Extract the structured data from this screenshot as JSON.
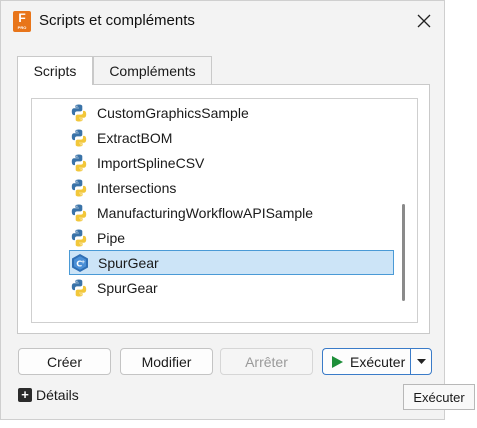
{
  "window": {
    "title": "Scripts et compléments",
    "app_icon_letter": "F",
    "app_icon_sub": "PRO"
  },
  "tabs": [
    {
      "label": "Scripts",
      "active": true
    },
    {
      "label": "Compléments",
      "active": false
    }
  ],
  "list": {
    "items": [
      {
        "label": "CustomGraphicsSample",
        "icon": "python-icon",
        "selected": false
      },
      {
        "label": "ExtractBOM",
        "icon": "python-icon",
        "selected": false
      },
      {
        "label": "ImportSplineCSV",
        "icon": "python-icon",
        "selected": false
      },
      {
        "label": "Intersections",
        "icon": "python-icon",
        "selected": false
      },
      {
        "label": "ManufacturingWorkflowAPISample",
        "icon": "python-icon",
        "selected": false
      },
      {
        "label": "Pipe",
        "icon": "python-icon",
        "selected": false
      },
      {
        "label": "SpurGear",
        "icon": "cpp-icon",
        "selected": true
      },
      {
        "label": "SpurGear",
        "icon": "python-icon",
        "selected": false
      }
    ]
  },
  "buttons": {
    "create": "Créer",
    "edit": "Modifier",
    "stop": "Arrêter",
    "run": "Exécuter"
  },
  "details_label": "Détails",
  "tooltip": "Exécuter",
  "colors": {
    "selection_bg": "#cce4f7",
    "selection_border": "#4a9ad6",
    "run_accent": "#3a7bc8",
    "play_green": "#1e8f3a",
    "app_orange": "#e8751a"
  }
}
